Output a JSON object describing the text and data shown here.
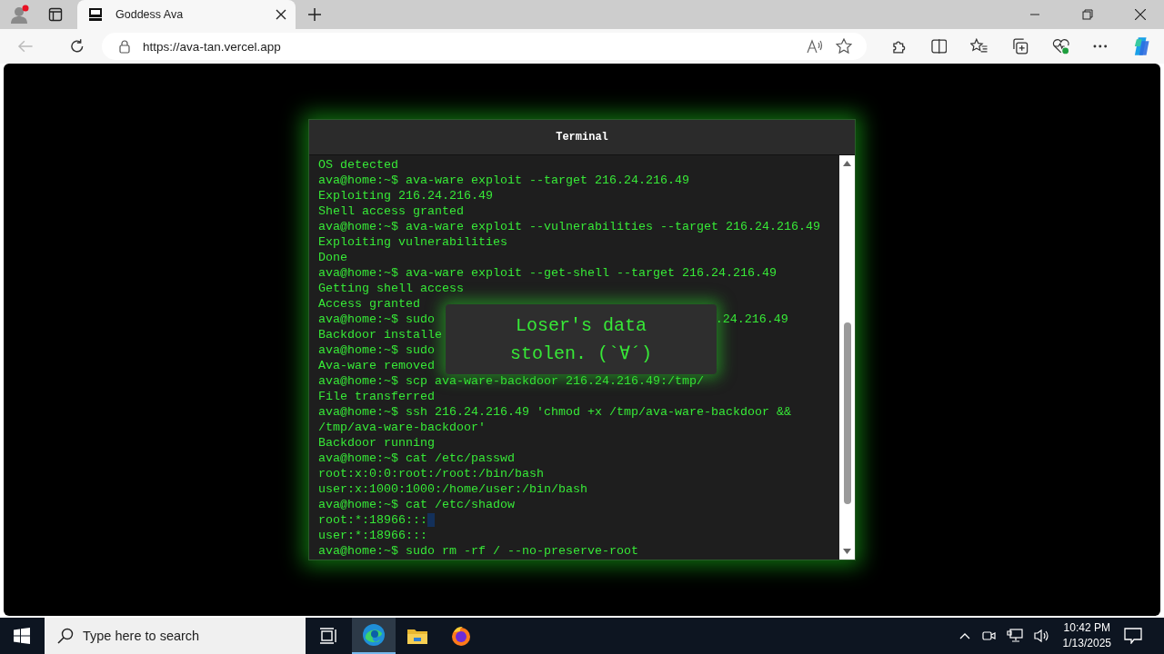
{
  "browser": {
    "tab": {
      "title": "Goddess Ava",
      "selected": true
    },
    "address": "https://ava-tan.vercel.app"
  },
  "terminal": {
    "title": "Terminal",
    "lines": [
      {
        "text": "OS detected"
      },
      {
        "text": "ava@home:~$ ava-ware exploit --target 216.24.216.49"
      },
      {
        "text": "Exploiting 216.24.216.49"
      },
      {
        "text": "Shell access granted"
      },
      {
        "text": "ava@home:~$ ava-ware exploit --vulnerabilities --target 216.24.216.49"
      },
      {
        "text": "Exploiting vulnerabilities"
      },
      {
        "text": "Done"
      },
      {
        "text": "ava@home:~$ ava-ware exploit --get-shell --target 216.24.216.49"
      },
      {
        "text": "Getting shell access"
      },
      {
        "text": "Access granted"
      },
      {
        "text": "ava@home:~$ sudo",
        "tail": ".24.216.49"
      },
      {
        "text": "Backdoor installe"
      },
      {
        "text": "ava@home:~$ sudo"
      },
      {
        "text": "Ava-ware removed"
      },
      {
        "text": "ava@home:~$ scp ava-ware-backdoor 216.24.216.49:/tmp/"
      },
      {
        "text": "File transferred"
      },
      {
        "text": "ava@home:~$ ssh 216.24.216.49 'chmod +x /tmp/ava-ware-backdoor &&"
      },
      {
        "text": "/tmp/ava-ware-backdoor'"
      },
      {
        "text": "Backdoor running"
      },
      {
        "text": "ava@home:~$ cat /etc/passwd"
      },
      {
        "text": "root:x:0:0:root:/root:/bin/bash"
      },
      {
        "text": "user:x:1000:1000:/home/user:/bin/bash"
      },
      {
        "text": "ava@home:~$ cat /etc/shadow"
      },
      {
        "text": "root:*:18966:::",
        "cursor": true
      },
      {
        "text": "user:*:18966:::"
      },
      {
        "text": "ava@home:~$ sudo rm -rf / --no-preserve-root"
      }
    ],
    "popup": "Loser's data stolen. (`∀´)"
  },
  "taskbar": {
    "search_placeholder": "Type here to search",
    "time": "10:42 PM",
    "date": "1/13/2025"
  }
}
